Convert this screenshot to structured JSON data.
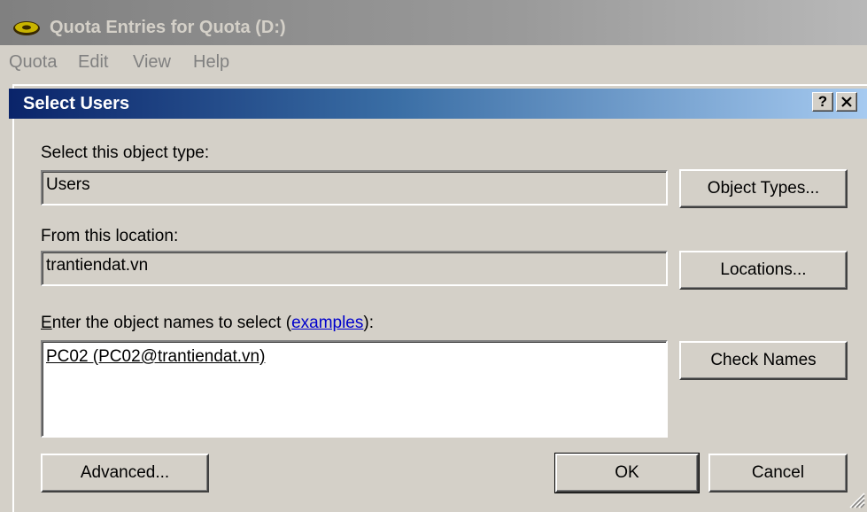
{
  "parent_window": {
    "title": "Quota Entries for Quota (D:)",
    "menu": [
      "Quota",
      "Edit",
      "View",
      "Help"
    ]
  },
  "dialog": {
    "title": "Select Users",
    "help_button": "?",
    "close_button": "✕",
    "object_type_label": "Select this object type:",
    "object_type_value": "Users",
    "object_types_button": "Object Types...",
    "location_label": "From this location:",
    "location_value": "trantiendat.vn",
    "locations_button": "Locations...",
    "names_label_prefix_underlined": "E",
    "names_label_prefix": "nter the object names to select (",
    "names_label_link": "examples",
    "names_label_suffix": "):",
    "names_value": "PC02 (PC02@trantiendat.vn)",
    "check_names_button": "Check Names",
    "advanced_button": "Advanced...",
    "ok_button": "OK",
    "cancel_button": "Cancel"
  },
  "icons": {
    "parent_title_icon": "disk-quota-icon",
    "resize_grip": "resize-grip-icon"
  },
  "colors": {
    "dialog_title_start": "#0a246a",
    "dialog_title_end": "#a6caf0",
    "face": "#d4d0c8",
    "link": "#0000cc"
  }
}
